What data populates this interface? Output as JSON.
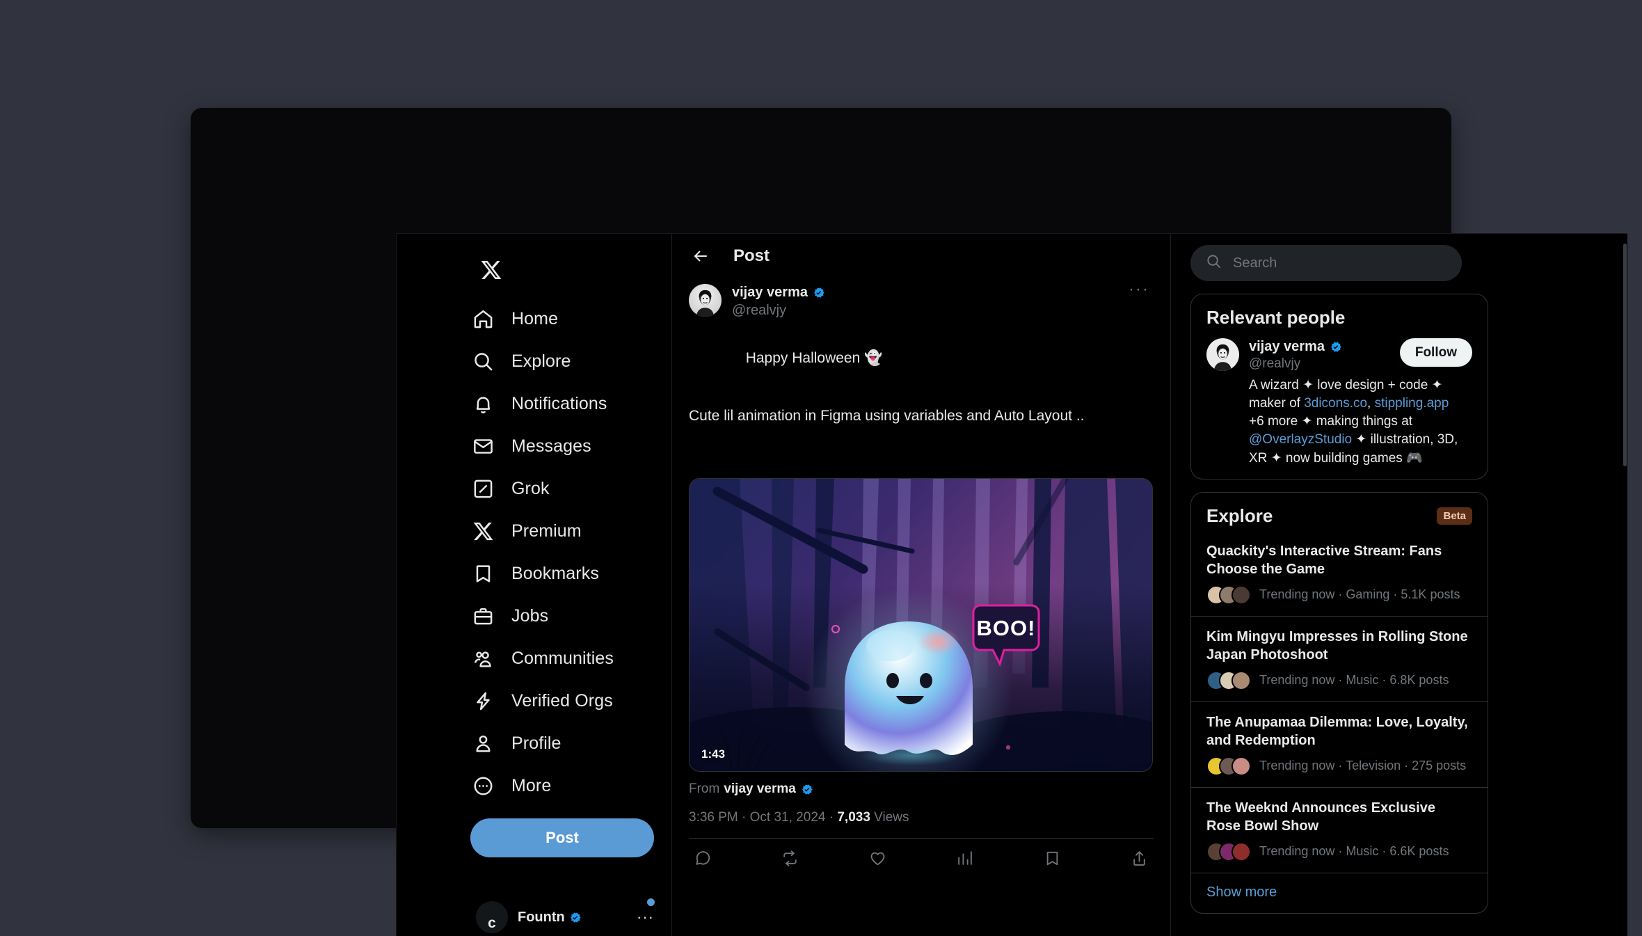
{
  "brand": {
    "accent": "#5b9bd5",
    "verified": "#1d9bf0",
    "beta_bg": "#5c2e15"
  },
  "sidebar": {
    "logo": "x-logo",
    "items": [
      {
        "label": "Home",
        "icon": "home-icon"
      },
      {
        "label": "Explore",
        "icon": "search-icon"
      },
      {
        "label": "Notifications",
        "icon": "bell-icon"
      },
      {
        "label": "Messages",
        "icon": "envelope-icon"
      },
      {
        "label": "Grok",
        "icon": "grok-icon"
      },
      {
        "label": "Premium",
        "icon": "x-icon"
      },
      {
        "label": "Bookmarks",
        "icon": "bookmark-icon"
      },
      {
        "label": "Jobs",
        "icon": "briefcase-icon"
      },
      {
        "label": "Communities",
        "icon": "people-icon"
      },
      {
        "label": "Verified Orgs",
        "icon": "lightning-icon"
      },
      {
        "label": "Profile",
        "icon": "person-icon"
      },
      {
        "label": "More",
        "icon": "more-circle-icon"
      }
    ],
    "post_button": "Post",
    "account": {
      "display_name": "Fountn",
      "avatar_letter": "c",
      "more": "···"
    }
  },
  "header": {
    "title": "Post",
    "back_icon": "arrow-left-icon"
  },
  "post": {
    "author": {
      "display_name": "vijay verma",
      "handle": "@realvjy"
    },
    "more_icon": "···",
    "text_line1": "Happy Halloween 👻",
    "text_line2": "Cute lil animation in Figma using variables and Auto Layout ..",
    "media": {
      "type": "video",
      "duration": "1:43",
      "speech_bubble": "BOO!",
      "alt": "glowing gradient ghost floating in a dark purple forest"
    },
    "from_label": "From",
    "from_name": "vijay verma",
    "timestamp": "3:36 PM",
    "date": "Oct 31, 2024",
    "views_count": "7,033",
    "views_label": "Views",
    "actions": [
      {
        "name": "reply",
        "count": ""
      },
      {
        "name": "repost",
        "count": ""
      },
      {
        "name": "like",
        "count": ""
      },
      {
        "name": "views",
        "count": ""
      },
      {
        "name": "bookmark",
        "count": ""
      },
      {
        "name": "share",
        "count": ""
      }
    ]
  },
  "search": {
    "placeholder": "Search",
    "value": "",
    "icon": "search-icon"
  },
  "relevant_people": {
    "title": "Relevant people",
    "person": {
      "display_name": "vijay verma",
      "handle": "@realvjy",
      "follow_label": "Follow",
      "bio_parts": [
        {
          "t": "A wizard ✦ love design + code ✦ maker of ",
          "link": false
        },
        {
          "t": "3dicons.co",
          "link": true
        },
        {
          "t": ", ",
          "link": false
        },
        {
          "t": "stippling.app",
          "link": true
        },
        {
          "t": " +6 more ✦ making things at ",
          "link": false
        },
        {
          "t": "@OverlayzStudio",
          "link": true
        },
        {
          "t": " ✦ illustration, 3D, XR ✦ now building games 🎮",
          "link": false
        }
      ]
    }
  },
  "explore": {
    "title": "Explore",
    "badge": "Beta",
    "show_more": "Show more",
    "trends": [
      {
        "headline": "Quackity's Interactive Stream: Fans Choose the Game",
        "meta": "Trending now · Gaming · 5.1K posts",
        "faces": [
          "#d9c2a6",
          "#8d7b6b",
          "#4a3a33"
        ]
      },
      {
        "headline": "Kim Mingyu Impresses in Rolling Stone Japan Photoshoot",
        "meta": "Trending now · Music · 6.8K posts",
        "faces": [
          "#2f5f86",
          "#d8cbb6",
          "#a98b74"
        ]
      },
      {
        "headline": "The Anupamaa Dilemma: Love, Loyalty, and Redemption",
        "meta": "Trending now · Television · 275 posts",
        "faces": [
          "#e8c630",
          "#6d5a52",
          "#c98d86"
        ]
      },
      {
        "headline": "The Weeknd Announces Exclusive Rose Bowl Show",
        "meta": "Trending now · Music · 6.6K posts",
        "faces": [
          "#5a4034",
          "#7c2a6a",
          "#8f2d2d"
        ]
      }
    ]
  }
}
